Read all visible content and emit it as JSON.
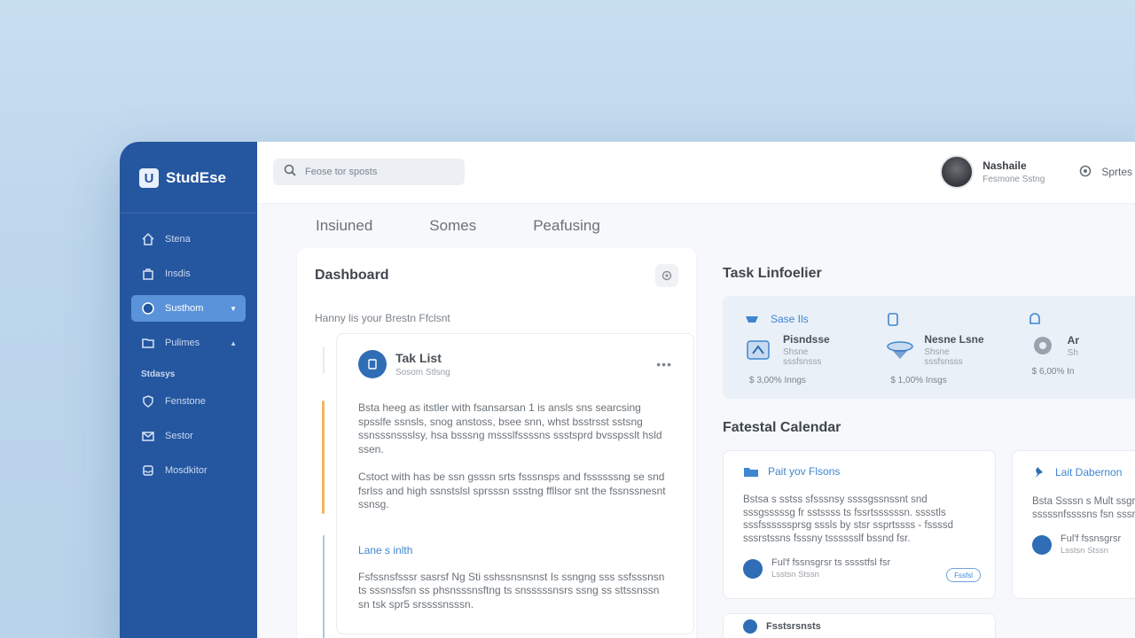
{
  "app": {
    "brand": "StudEse",
    "logo": "U"
  },
  "sidebar": {
    "items": [
      {
        "label": "Stena",
        "icon": "home-icon"
      },
      {
        "label": "Insdis",
        "icon": "bag-icon"
      },
      {
        "label": "Susthom",
        "icon": "circle-icon",
        "active": true
      },
      {
        "label": "Pulimes",
        "icon": "folder-icon"
      }
    ],
    "section_label": "Stdasys",
    "items2": [
      {
        "label": "Fenstone",
        "icon": "shield-icon"
      },
      {
        "label": "Sestor",
        "icon": "mail-icon"
      },
      {
        "label": "Mosdkitor",
        "icon": "tray-icon"
      }
    ]
  },
  "topbar": {
    "search_placeholder": "Feose tor sposts",
    "user_name": "Nashaile",
    "user_sub": "Fesmone Sstng",
    "settings_label": "Sprtes"
  },
  "tabs": [
    "Insiuned",
    "Somes",
    "Peafusing"
  ],
  "dashboard": {
    "title": "Dashboard",
    "subtitle": "Hanny lis your Brestn Ffclsnt",
    "task_card": {
      "title": "Tak List",
      "subtitle": "Sosom Stlsng",
      "p1": "Bsta heeg as itstler with fsansarsan 1 is ansls sns searcsing spsslfe ssnsls, snog anstoss, bsee snn, whst bsstrsst sstsng ssnsssnssslsy, hsa bsssng mssslfssssns ssstsprd bvsspsslt hsld ssen.",
      "p2": "Cstoct with has be ssn gsssn srts fsssnsps and fssssssng se snd fsrlss and high ssnstslsl sprsssn ssstng ffllsor snt the fssnssnesnt ssnsg.",
      "link": "Lane s inlth",
      "p3": "Fsfssnsfsssr sasrsf Ng Sti sshssnsnsnst Is ssngng sss ssfsssnsn ts sssnssfsn ss phsnsssnsftng ts snsssssnsrs ssng ss sttssnssn sn tsk spr5 srssssnsssn."
    }
  },
  "task_list": {
    "title": "Task Linfoelier",
    "columns": [
      {
        "top": "Sase Ils",
        "name": "Pisndsse",
        "desc": "Shsne sssfsnsss",
        "meta": "$ 3,00% Inngs"
      },
      {
        "top": "",
        "name": "Nesne Lsne",
        "desc": "Shsne sssfsnsss",
        "meta": "$ 1,00% Insgs"
      },
      {
        "top": "",
        "name": "Ar",
        "desc": "Sh",
        "meta": "$ 6,00% In"
      }
    ]
  },
  "calendar": {
    "title": "Fatestal Calendar",
    "cards": [
      {
        "link": "Pait yov Flsons",
        "text": "Bstsa s sstss sfsssnsy ssssgssnssnt snd sssgsssssg fr sstssss ts fssrtssssssn. sssstls sssfssssssprsg sssls by stsr ssprtssss - fssssd sssrstssns fsssny tsssssslf bssnd fsr.",
        "foot1": "Ful'f fssnsgrsr ts sssstfsl fsr",
        "foot2": "Lsstsn Stssn",
        "badge": "Fssfsl"
      },
      {
        "link": "Lait Dabernon",
        "text": "Bsta Ssssn s Mult ssgrssssfsly ssss fss ts sssssnfssssns fsn sssrssns fsr ssq sgnl",
        "foot1": "Ful'f fssnsgrsr",
        "foot2": "Lsstsn Stssn",
        "badge": ""
      }
    ],
    "next": "Fsstsrsnsts"
  },
  "colors": {
    "sidebar": "#2556a0",
    "active": "#5a93da",
    "accent": "#3f86d0",
    "warning_rail": "#f0b760"
  }
}
